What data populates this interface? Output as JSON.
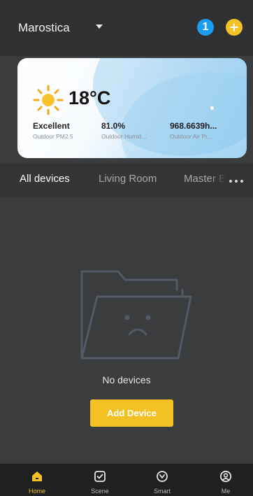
{
  "header": {
    "home_name": "Marostica",
    "notification_count": "1"
  },
  "weather": {
    "temperature": "18°C",
    "icon": "sun-icon",
    "stats": [
      {
        "value": "Excellent",
        "label": "Outdoor PM2.5"
      },
      {
        "value": "81.0%",
        "label": "Outdoor Humid..."
      },
      {
        "value": "968.6639h...",
        "label": "Outdoor Air Pr..."
      }
    ]
  },
  "rooms": {
    "tabs": [
      "All devices",
      "Living Room",
      "Master E"
    ],
    "active": "All devices",
    "more_icon": "more-dots-icon"
  },
  "empty_state": {
    "message": "No devices",
    "button_label": "Add Device"
  },
  "bottom_nav": {
    "items": [
      {
        "label": "Home",
        "icon": "home-icon",
        "active": true
      },
      {
        "label": "Scene",
        "icon": "scene-icon",
        "active": false
      },
      {
        "label": "Smart",
        "icon": "smart-icon",
        "active": false
      },
      {
        "label": "Me",
        "icon": "profile-icon",
        "active": false
      }
    ]
  },
  "colors": {
    "accent": "#f3c124",
    "badge": "#1a9cf0",
    "background": "#3b3c3d",
    "nav_background": "#1f2021"
  }
}
